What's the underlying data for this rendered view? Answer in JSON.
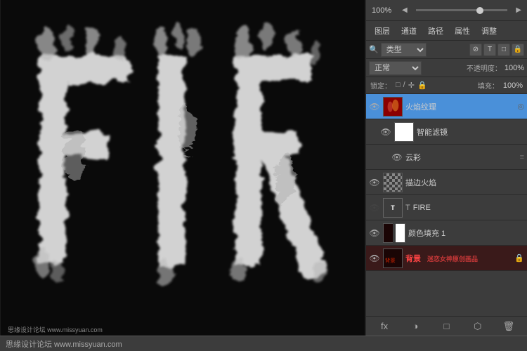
{
  "zoom": {
    "level": "100%",
    "arrow_left": "◀",
    "arrow_right": "▶"
  },
  "tabs": {
    "items": [
      "图层",
      "通道",
      "路径",
      "属性",
      "调整"
    ]
  },
  "filter": {
    "search_icon": "🔍",
    "type_label": "类型",
    "icons": [
      "⊘",
      "T",
      "□",
      "🔒"
    ]
  },
  "blend": {
    "mode": "正常",
    "opacity_label": "不透明度：",
    "opacity_value": "100%"
  },
  "lock": {
    "label": "锁定：",
    "icons": [
      "□",
      "/",
      "✛",
      "🔒"
    ],
    "fill_label": "填充：",
    "fill_value": "100%"
  },
  "layers": [
    {
      "id": "fire-texture",
      "visible": true,
      "thumb_type": "fire-thumb",
      "name": "火焰纹理",
      "right_icon": "◎",
      "level": 0,
      "has_chain": false
    },
    {
      "id": "smart-filter",
      "visible": true,
      "thumb_type": "white-thumb",
      "name": "智能滤镜",
      "right_icon": "",
      "level": 1,
      "has_chain": false
    },
    {
      "id": "cloud",
      "visible": true,
      "thumb_type": "none",
      "name": "云彩",
      "right_icon": "≡",
      "level": 2,
      "has_chain": false
    },
    {
      "id": "edge-flame",
      "visible": true,
      "thumb_type": "checker",
      "name": "描边火焰",
      "right_icon": "",
      "level": 0,
      "has_chain": false
    },
    {
      "id": "fire-text",
      "visible": false,
      "thumb_type": "type",
      "name": "FIRE",
      "right_icon": "",
      "level": 0,
      "has_chain": false,
      "is_type": true
    },
    {
      "id": "color-fill",
      "visible": true,
      "thumb_type": "color-fill",
      "name": "颜色填充 1",
      "right_icon": "",
      "level": 0,
      "has_chain": true
    },
    {
      "id": "background",
      "visible": true,
      "thumb_type": "bg-thumb",
      "name": "背景",
      "right_icon": "🔒",
      "level": 0,
      "has_chain": true,
      "highlighted": true
    }
  ],
  "bottom_bar": {
    "text": "思缘设计论坛 www.missyuan.com"
  },
  "panel_bottom": {
    "buttons": [
      "fx",
      "□",
      "⬡",
      "⬜",
      "🗑"
    ]
  }
}
